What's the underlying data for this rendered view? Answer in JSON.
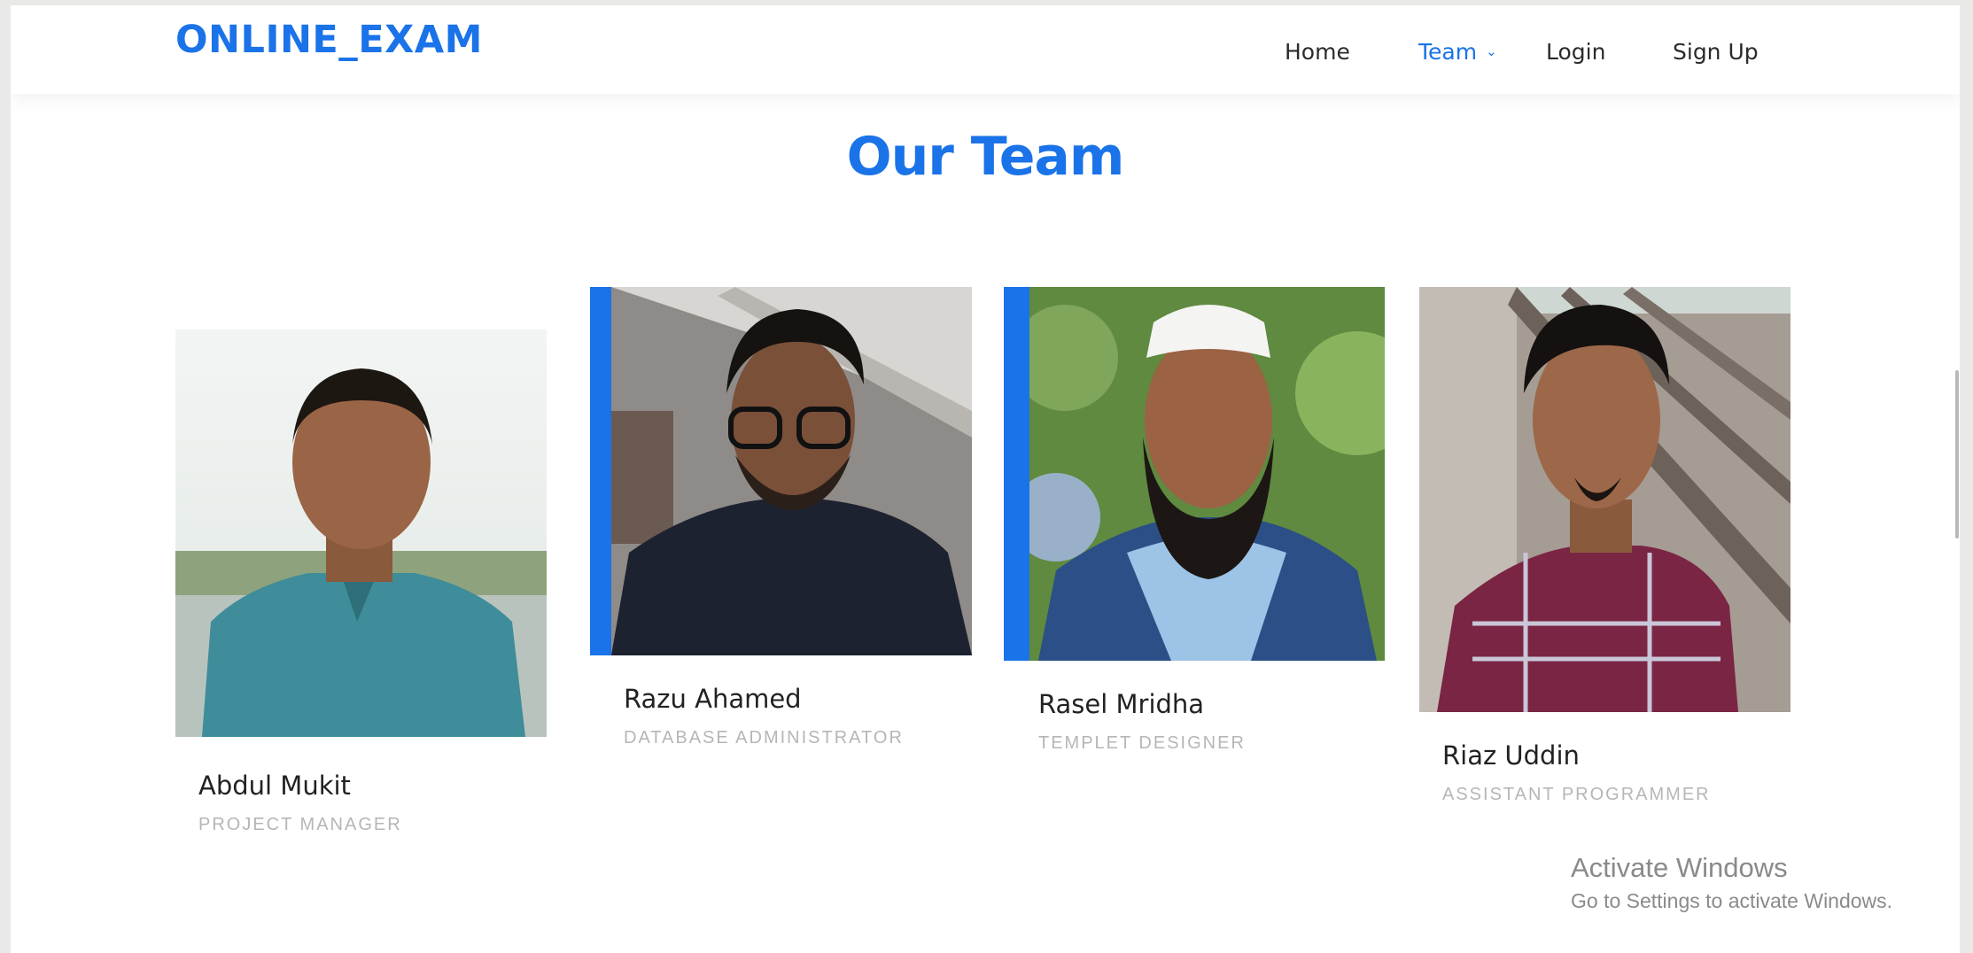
{
  "brand": "ONLINE_EXAM",
  "nav": {
    "home": "Home",
    "team": "Team",
    "login": "Login",
    "signup": "Sign Up"
  },
  "section": {
    "title": "Our Team"
  },
  "team": [
    {
      "name": "Abdul Mukit",
      "role": "PROJECT MANAGER"
    },
    {
      "name": "Razu Ahamed",
      "role": "DATABASE ADMINISTRATOR"
    },
    {
      "name": "Rasel Mridha",
      "role": "TEMPLET DESIGNER"
    },
    {
      "name": "Riaz Uddin",
      "role": "ASSISTANT PROGRAMMER"
    }
  ],
  "watermark": {
    "title": "Activate Windows",
    "subtitle": "Go to Settings to activate Windows."
  },
  "colors": {
    "accent": "#1a73e8",
    "role_text": "#b6b6b6"
  }
}
